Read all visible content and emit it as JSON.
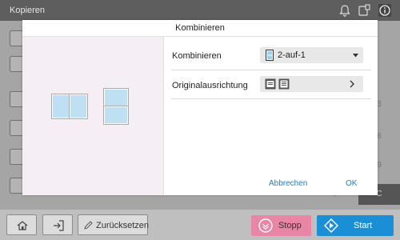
{
  "topbar": {
    "title": "Kopieren"
  },
  "dialog": {
    "title": "Kombinieren",
    "rows": [
      {
        "label": "Kombinieren",
        "value": "2-auf-1"
      },
      {
        "label": "Originalausrichtung"
      }
    ],
    "cancel_label": "Abbrechen",
    "ok_label": "OK"
  },
  "background_keys": [
    "3",
    "6",
    "9",
    "C",
    "0"
  ],
  "bottombar": {
    "reset_label": "Zurücksetzen",
    "stop_label": "Stopp",
    "start_label": "Start"
  },
  "colors": {
    "accent_blue": "#1a8fd6",
    "stop_pink": "#e986a6",
    "link_blue": "#1a7ec7",
    "preview_bg": "#f6eef5"
  }
}
